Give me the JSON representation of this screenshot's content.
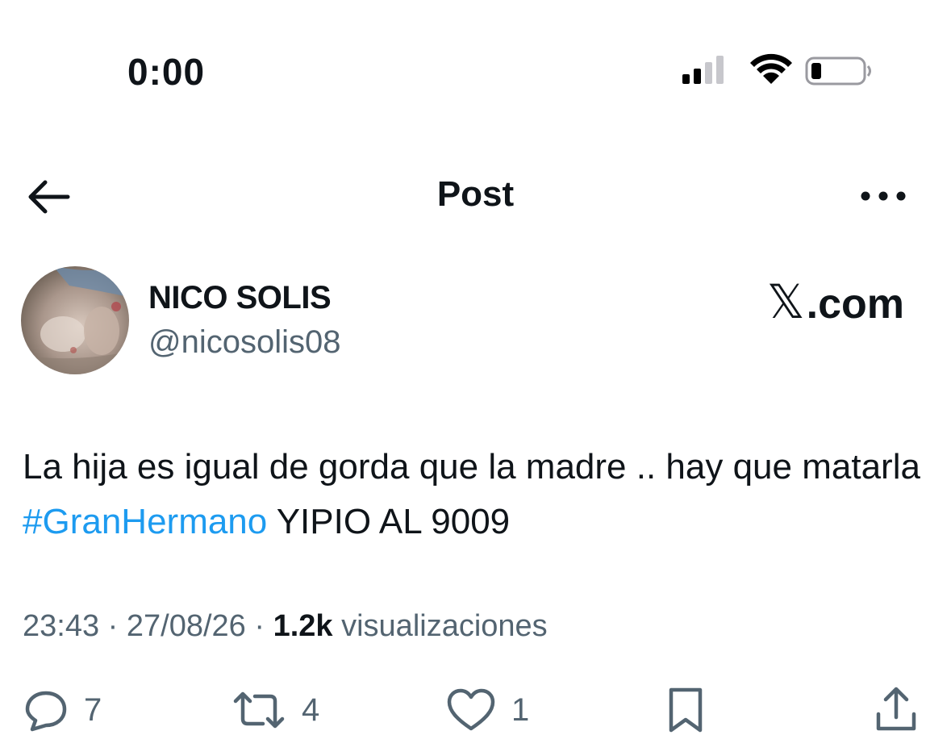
{
  "status_bar": {
    "time": "0:00",
    "signal_icon": "cellular-signal-icon",
    "wifi_icon": "wifi-icon",
    "battery_icon": "battery-low-icon"
  },
  "header": {
    "back_icon": "back-arrow-icon",
    "title": "Post",
    "more_icon": "more-dots-icon"
  },
  "author": {
    "display_name": "NICO SOLIS",
    "handle": "@nicosolis08"
  },
  "brand": {
    "logo": "x-logo",
    "text": ".com"
  },
  "post": {
    "text_before": "La hija es igual de gorda que la madre .. hay que matarla ",
    "hashtag": "#GranHermano",
    "text_after": " YIPIO AL 9009"
  },
  "meta": {
    "time": "23:43",
    "separator": "·",
    "date": "27/08/26",
    "views_count": "1.2k",
    "views_label": "visualizaciones"
  },
  "actions": {
    "reply": {
      "icon": "reply-icon",
      "count": "7"
    },
    "repost": {
      "icon": "repost-icon",
      "count": "4"
    },
    "like": {
      "icon": "heart-icon",
      "count": "1"
    },
    "bookmark": {
      "icon": "bookmark-icon"
    },
    "share": {
      "icon": "share-icon"
    }
  },
  "colors": {
    "text": "#0f1419",
    "secondary": "#536471",
    "link": "#1d9bf0"
  }
}
